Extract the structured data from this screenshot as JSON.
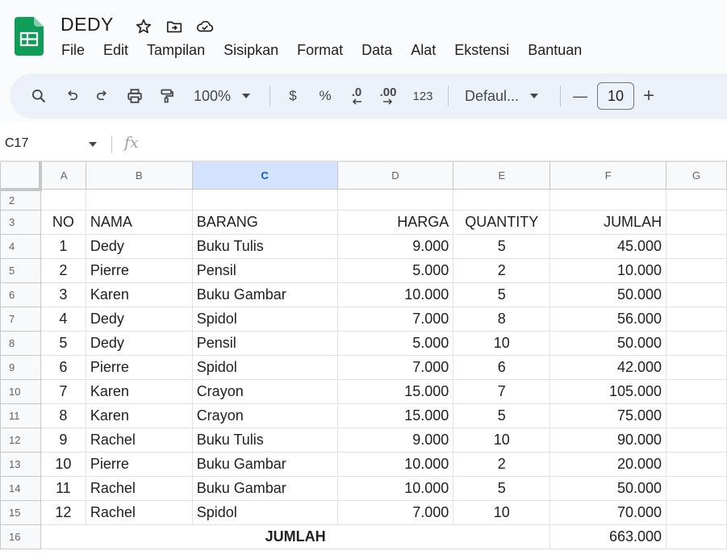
{
  "doc": {
    "title": "DEDY",
    "menu": [
      "File",
      "Edit",
      "Tampilan",
      "Sisipkan",
      "Format",
      "Data",
      "Alat",
      "Ekstensi",
      "Bantuan"
    ]
  },
  "toolbar": {
    "zoom": "100%",
    "currency": "$",
    "percent": "%",
    "dec_decrease": ".0",
    "dec_increase": ".00",
    "number_format": "123",
    "font": "Defaul...",
    "font_size": "10",
    "minus": "—",
    "plus": "+"
  },
  "formula_bar": {
    "name_box": "C17",
    "fx": "fx",
    "formula": ""
  },
  "sheet": {
    "columns": [
      "A",
      "B",
      "C",
      "D",
      "E",
      "F",
      "G"
    ],
    "selected_column": "C",
    "rows": [
      {
        "n": "2",
        "no": "",
        "nama": "",
        "barang": "",
        "harga": "",
        "qty": "",
        "jumlah": ""
      },
      {
        "n": "3",
        "no": "NO",
        "nama": "NAMA",
        "barang": "BARANG",
        "harga": "HARGA",
        "qty": "QUANTITY",
        "jumlah": "JUMLAH"
      },
      {
        "n": "4",
        "no": "1",
        "nama": "Dedy",
        "barang": "Buku Tulis",
        "harga": "9.000",
        "qty": "5",
        "jumlah": "45.000"
      },
      {
        "n": "5",
        "no": "2",
        "nama": "Pierre",
        "barang": "Pensil",
        "harga": "5.000",
        "qty": "2",
        "jumlah": "10.000"
      },
      {
        "n": "6",
        "no": "3",
        "nama": "Karen",
        "barang": "Buku Gambar",
        "harga": "10.000",
        "qty": "5",
        "jumlah": "50.000"
      },
      {
        "n": "7",
        "no": "4",
        "nama": "Dedy",
        "barang": "Spidol",
        "harga": "7.000",
        "qty": "8",
        "jumlah": "56.000"
      },
      {
        "n": "8",
        "no": "5",
        "nama": "Dedy",
        "barang": "Pensil",
        "harga": "5.000",
        "qty": "10",
        "jumlah": "50.000"
      },
      {
        "n": "9",
        "no": "6",
        "nama": "Pierre",
        "barang": "Spidol",
        "harga": "7.000",
        "qty": "6",
        "jumlah": "42.000"
      },
      {
        "n": "10",
        "no": "7",
        "nama": "Karen",
        "barang": "Crayon",
        "harga": "15.000",
        "qty": "7",
        "jumlah": "105.000"
      },
      {
        "n": "11",
        "no": "8",
        "nama": "Karen",
        "barang": "Crayon",
        "harga": "15.000",
        "qty": "5",
        "jumlah": "75.000"
      },
      {
        "n": "12",
        "no": "9",
        "nama": "Rachel",
        "barang": "Buku Tulis",
        "harga": "9.000",
        "qty": "10",
        "jumlah": "90.000"
      },
      {
        "n": "13",
        "no": "10",
        "nama": "Pierre",
        "barang": "Buku Gambar",
        "harga": "10.000",
        "qty": "2",
        "jumlah": "20.000"
      },
      {
        "n": "14",
        "no": "11",
        "nama": "Rachel",
        "barang": "Buku Gambar",
        "harga": "10.000",
        "qty": "5",
        "jumlah": "50.000"
      },
      {
        "n": "15",
        "no": "12",
        "nama": "Rachel",
        "barang": "Spidol",
        "harga": "7.000",
        "qty": "10",
        "jumlah": "70.000"
      }
    ],
    "total_row": {
      "n": "16",
      "label": "JUMLAH",
      "value": "663.000"
    }
  }
}
